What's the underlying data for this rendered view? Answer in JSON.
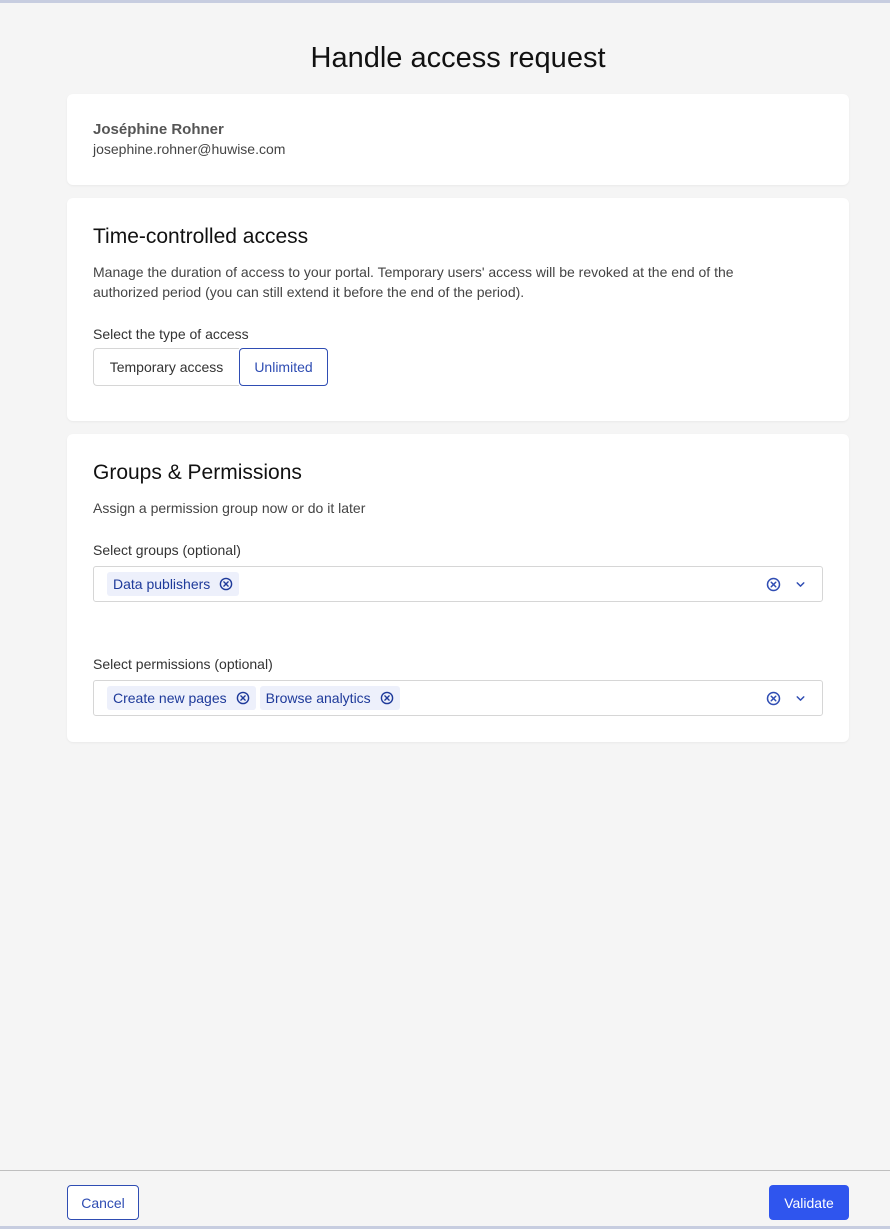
{
  "page": {
    "title": "Handle access request"
  },
  "user": {
    "name": "Joséphine Rohner",
    "email": "josephine.rohner@huwise.com"
  },
  "time_access": {
    "title": "Time-controlled access",
    "description": "Manage the duration of access to your portal. Temporary users' access will be revoked at the end of the authorized period (you can still extend it before the end of the period).",
    "type_label": "Select the type of access",
    "options": [
      "Temporary access",
      "Unlimited"
    ],
    "selected": "Unlimited"
  },
  "groups": {
    "title": "Groups & Permissions",
    "description": "Assign a permission group now or do it later",
    "groups_label": "Select groups (optional)",
    "groups_selected": [
      "Data publishers"
    ],
    "permissions_label": "Select permissions (optional)",
    "permissions_selected": [
      "Create new pages",
      "Browse analytics"
    ]
  },
  "footer": {
    "cancel_label": "Cancel",
    "validate_label": "Validate"
  },
  "colors": {
    "accent": "#2f55ee",
    "chip_bg": "#edf0fb",
    "chip_text": "#1e3a9a"
  }
}
